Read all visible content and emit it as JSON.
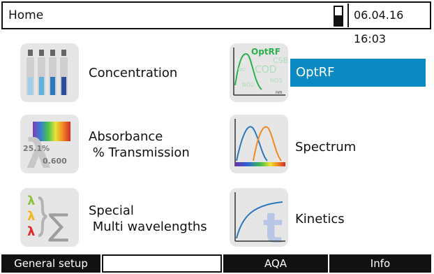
{
  "header": {
    "title": "Home",
    "datetime": "06.04.16 16:03",
    "battery_level": 0.55
  },
  "menu": {
    "concentration": {
      "label": "Concentration"
    },
    "optrf": {
      "label": "OptRF",
      "icon_title": "OptRF",
      "icon_params": [
        "CSB",
        "COD",
        "NO",
        "NO3",
        "NO2"
      ],
      "icon_unit": "nm"
    },
    "absorbance": {
      "label": "Absorbance\n % Transmission",
      "icon_percent": "25.1%",
      "icon_value": "0.600",
      "icon_symbol": "λ"
    },
    "spectrum": {
      "label": "Spectrum"
    },
    "special": {
      "label": "Special\n Multi wavelengths",
      "icon_symbol": "λ",
      "icon_sigma": "∑"
    },
    "kinetics": {
      "label": "Kinetics",
      "icon_letter": "t"
    }
  },
  "softkeys": [
    {
      "label": "General setup"
    },
    {
      "label": ""
    },
    {
      "label": "AQA"
    },
    {
      "label": "Info"
    }
  ],
  "colors": {
    "selection": "#0a89c3",
    "optrf_green": "#2bb24c"
  }
}
